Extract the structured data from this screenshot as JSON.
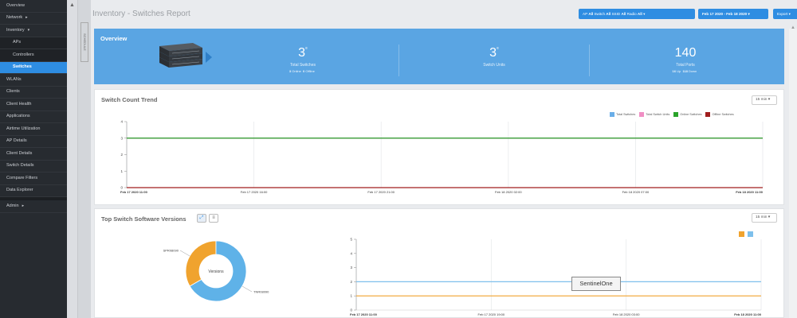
{
  "sidebar": {
    "items": [
      {
        "label": "Overview",
        "type": "item"
      },
      {
        "label": "Network",
        "type": "item",
        "chevron": "▸"
      },
      {
        "label": "Inventory",
        "type": "item",
        "chevron": "▾"
      },
      {
        "label": "APs",
        "type": "sub"
      },
      {
        "label": "Controllers",
        "type": "sub"
      },
      {
        "label": "Switches",
        "type": "sub",
        "active": true
      },
      {
        "label": "WLANs",
        "type": "item"
      },
      {
        "label": "Clients",
        "type": "item"
      },
      {
        "label": "Client Health",
        "type": "item"
      },
      {
        "label": "Applications",
        "type": "item"
      },
      {
        "label": "Airtime Utilization",
        "type": "item"
      },
      {
        "label": "AP Details",
        "type": "item"
      },
      {
        "label": "Client Details",
        "type": "item"
      },
      {
        "label": "Switch Details",
        "type": "item"
      },
      {
        "label": "Compare Filters",
        "type": "item"
      },
      {
        "label": "Data Explorer",
        "type": "item"
      },
      {
        "label": "Admin",
        "type": "item",
        "chevron": "▸",
        "gap_before": true
      }
    ]
  },
  "schedule_label": "SCHEDULE",
  "header": {
    "title": "Inventory - Switches Report",
    "filters": [
      {
        "key": "AP",
        "value": "All"
      },
      {
        "key": "Switch",
        "value": "All"
      },
      {
        "key": "SSID",
        "value": "All"
      },
      {
        "key": "Radio",
        "value": "All"
      }
    ],
    "filter_caret": "▾",
    "date_range": "Feb 17 2020 - Feb 18 2020",
    "date_caret": "▾",
    "export_label": "Export",
    "export_caret": "▾"
  },
  "overview": {
    "title": "Overview",
    "stats": [
      {
        "value": "3",
        "sup": "≡",
        "label": "Total Switches",
        "sub": [
          {
            "n": "3",
            "t": "Online"
          },
          {
            "n": "0",
            "t": "Offline"
          }
        ]
      },
      {
        "value": "3",
        "sup": "≡",
        "label": "Switch Units",
        "sub": []
      },
      {
        "value": "140",
        "sup": "",
        "label": "Total Ports",
        "sub": [
          {
            "n": "16",
            "t": "Up"
          },
          {
            "n": "118",
            "t": "Down"
          }
        ]
      }
    ]
  },
  "trend": {
    "title": "Switch Count Trend",
    "interval": "15 min",
    "interval_caret": "▾"
  },
  "versions": {
    "title": "Top Switch Software Versions",
    "interval": "15 min",
    "interval_caret": "▾",
    "toggle_chart_icon": "📈",
    "toggle_list_icon": "≡",
    "donut_center": "Versions",
    "tooltip": "SentinelOne"
  },
  "chart_data": [
    {
      "type": "line",
      "title": "Switch Count Trend",
      "x": [
        "Feb 17 2020 11:00",
        "Feb 17 2020 16:00",
        "Feb 17 2020 21:00",
        "Feb 18 2020 02:00",
        "Feb 18 2020 07:00",
        "Feb 18 2020 11:00"
      ],
      "ylim": [
        0,
        4
      ],
      "yticks": [
        "0",
        "1",
        "2",
        "3",
        "4"
      ],
      "series": [
        {
          "name": "Total Switches",
          "color": "#6aaee8",
          "values": [
            3,
            3,
            3,
            3,
            3,
            3
          ]
        },
        {
          "name": "Total Switch Units",
          "color": "#f08fc4",
          "values": [
            3,
            3,
            3,
            3,
            3,
            3
          ]
        },
        {
          "name": "Online Switches",
          "color": "#2aa32a",
          "values": [
            3,
            3,
            3,
            3,
            3,
            3
          ]
        },
        {
          "name": "Offline Switches",
          "color": "#a01e1e",
          "values": [
            0,
            0,
            0,
            0,
            0,
            0
          ]
        }
      ],
      "grid": true,
      "legend": "top-right"
    },
    {
      "type": "pie",
      "slices": [
        {
          "name": "SPR08090",
          "value": 1,
          "color": "#f0a32e"
        },
        {
          "name": "TNR08090",
          "value": 2,
          "color": "#5fb2e8"
        }
      ]
    },
    {
      "type": "line",
      "x": [
        "Feb 17 2020 11:00",
        "Feb 17 2020 19:00",
        "Feb 18 2020 03:00",
        "Feb 18 2020 11:00"
      ],
      "ylim": [
        0,
        5
      ],
      "yticks": [
        "0",
        "1",
        "2",
        "3",
        "4",
        "5"
      ],
      "series": [
        {
          "color": "#f0a32e",
          "values": [
            1,
            1,
            1,
            1
          ]
        },
        {
          "color": "#7ec0ec",
          "values": [
            2,
            2,
            2,
            2
          ]
        }
      ],
      "grid": true,
      "legend": "top-right"
    }
  ]
}
